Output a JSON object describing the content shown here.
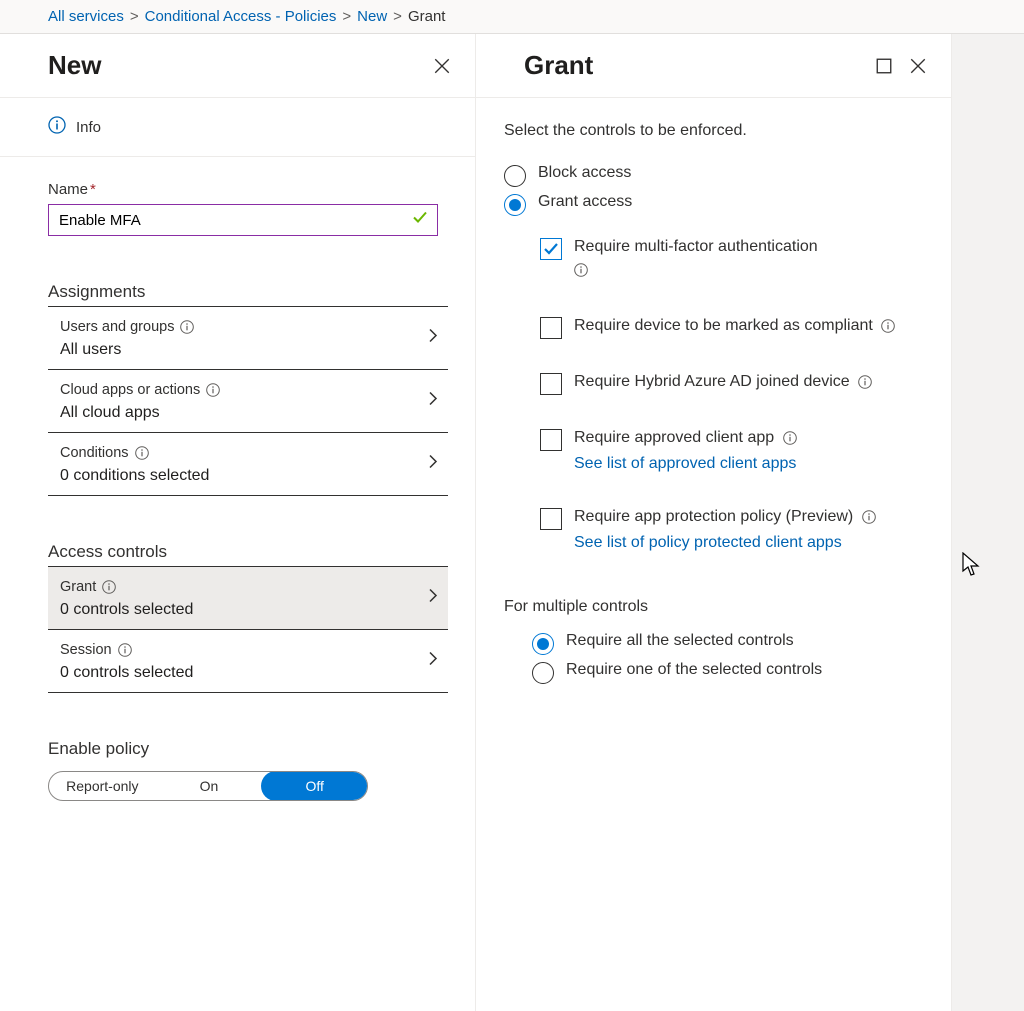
{
  "breadcrumb": {
    "items": [
      "All services",
      "Conditional Access - Policies",
      "New"
    ],
    "current": "Grant"
  },
  "left": {
    "title": "New",
    "info_label": "Info",
    "name_label": "Name",
    "name_value": "Enable MFA",
    "assignments_heading": "Assignments",
    "assignments": {
      "users": {
        "label": "Users and groups",
        "value": "All users"
      },
      "apps": {
        "label": "Cloud apps or actions",
        "value": "All cloud apps"
      },
      "conditions": {
        "label": "Conditions",
        "value": "0 conditions selected"
      }
    },
    "access_controls_heading": "Access controls",
    "access": {
      "grant": {
        "label": "Grant",
        "value": "0 controls selected"
      },
      "session": {
        "label": "Session",
        "value": "0 controls selected"
      }
    },
    "enable_policy_heading": "Enable policy",
    "enable_policy_options": {
      "report": "Report-only",
      "on": "On",
      "off": "Off"
    },
    "enable_policy_selected": "off"
  },
  "right": {
    "title": "Grant",
    "lead": "Select the controls to be enforced.",
    "radio": {
      "block": "Block access",
      "grant": "Grant access",
      "selected": "grant"
    },
    "checks": {
      "mfa": {
        "label": "Require multi-factor authentication",
        "checked": true
      },
      "compliant": {
        "label": "Require device to be marked as compliant",
        "checked": false
      },
      "hybrid": {
        "label": "Require Hybrid Azure AD joined device",
        "checked": false
      },
      "approved": {
        "label": "Require approved client app",
        "link": "See list of approved client apps",
        "checked": false
      },
      "apppolicy": {
        "label": "Require app protection policy (Preview)",
        "link": "See list of policy protected client apps",
        "checked": false
      }
    },
    "multi_heading": "For multiple controls",
    "multi": {
      "all": "Require all the selected controls",
      "one": "Require one of the selected controls",
      "selected": "all"
    }
  }
}
